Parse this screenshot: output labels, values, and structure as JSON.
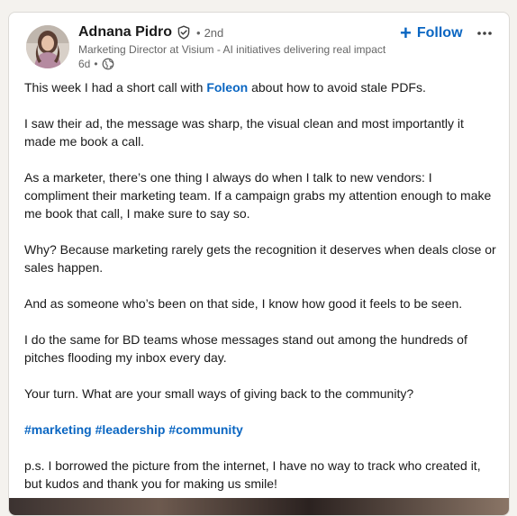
{
  "author": {
    "name": "Adnana Pidro",
    "degree": "2nd",
    "headline": "Marketing Director at Visium - AI initiatives delivering real impact",
    "time": "6d",
    "dot": "•"
  },
  "actions": {
    "follow_plus": "+",
    "follow_label": "Follow"
  },
  "post": {
    "p1_before": "This week I had a short call with ",
    "p1_link": "Foleon",
    "p1_after": " about how to avoid stale PDFs.",
    "p2": "I saw their ad, the message was sharp, the visual clean and most importantly it made me book a call.",
    "p3": "As a marketer, there’s one thing I always do when I talk to new vendors: I compliment their marketing team. If a campaign grabs my attention enough to make me book that call, I make sure to say so.",
    "p4": "Why? Because marketing rarely gets the recognition it deserves when deals close or sales happen.",
    "p5": "And as someone who’s been on that side, I know how good it feels to be seen.",
    "p6": "I do the same for BD teams whose messages stand out among the hundreds of pitches flooding my inbox every day.",
    "p7": "Your turn. What are your small ways of giving back to the community?",
    "hashtags": [
      "#marketing",
      "#leadership",
      "#community"
    ],
    "p8": "p.s. I borrowed the picture from the internet, I have no way to track who created it, but kudos and thank you for making us smile!"
  },
  "icons": {
    "verified": "verified-shield-icon",
    "visibility": "globe-icon",
    "menu": "more-horizontal-icon"
  },
  "colors": {
    "link": "#0a66c2",
    "muted": "#666666",
    "background": "#f4f2ee"
  }
}
